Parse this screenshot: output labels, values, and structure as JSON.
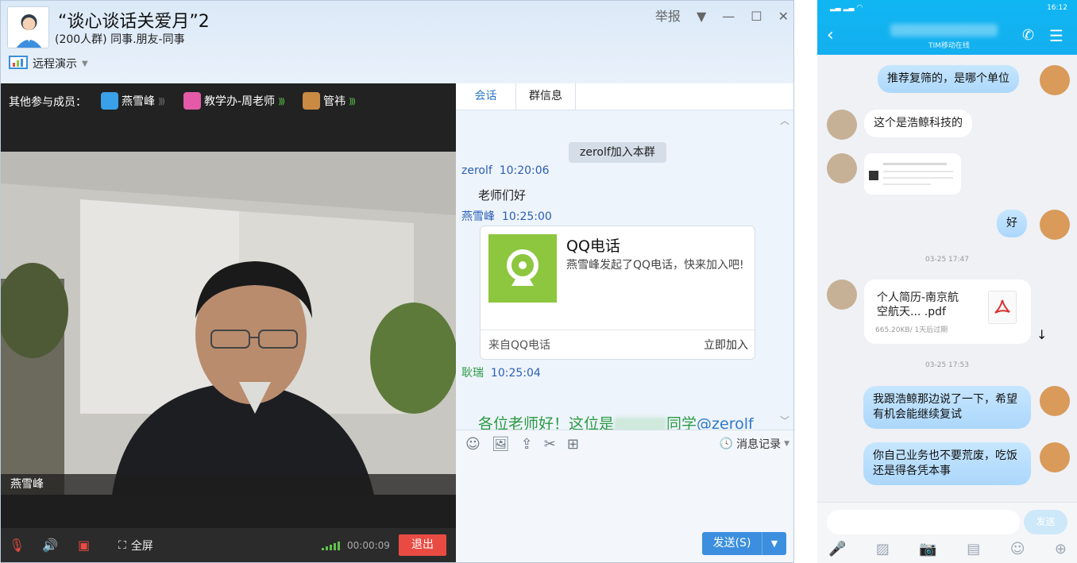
{
  "window": {
    "title": "“谈心谈话关爱月”2",
    "subtitle": "(200人群) 同事.朋友-同事",
    "report": "举报",
    "remote_demo": "远程演示"
  },
  "video": {
    "members_label": "其他参与成员：",
    "members": [
      {
        "name": "燕雪峰",
        "color": "#3aa0e8"
      },
      {
        "name": "教学办-周老师",
        "color": "#e55aa8"
      },
      {
        "name": "管祎",
        "color": "#c98a43"
      }
    ],
    "speaker_name": "燕雪峰",
    "fullscreen_label": "全屏",
    "timer": "00:00:09",
    "exit_label": "退出"
  },
  "chat": {
    "tabs": [
      "会话",
      "群信息"
    ],
    "system_message": "zerolf加入本群",
    "messages": [
      {
        "sender": "zerolf",
        "time": "10:20:06",
        "text": "老师们好"
      },
      {
        "sender": "燕雪峰",
        "time": "10:25:00"
      },
      {
        "sender": "耿瑞",
        "time": "10:25:04"
      }
    ],
    "card": {
      "title": "QQ电话",
      "desc": "燕雪峰发起了QQ电话，快来加入吧!",
      "from": "来自QQ电话",
      "join": "立即加入"
    },
    "last_msg_prefix": "各位老师好！这位是",
    "last_msg_suffix": "同学",
    "last_msg_mention": "@zerolf",
    "history_label": "消息记录",
    "send_label": "发送(S)"
  },
  "phone": {
    "contact_status": "TIM移动在线",
    "status_time": "16:12",
    "messages": [
      {
        "side": "me",
        "text": "推荐复筛的，是哪个单位"
      },
      {
        "side": "them",
        "text": "这个是浩鲸科技的"
      },
      {
        "side": "me",
        "text": "好"
      },
      {
        "side": "me",
        "text": "我跟浩鲸那边说了一下，希望有机会能继续复试"
      },
      {
        "side": "me",
        "text": "你自己业务也不要荒废，吃饭还是得各凭本事"
      }
    ],
    "times": [
      "03-25 17:47",
      "03-25 17:53"
    ],
    "file": {
      "name_line1": "个人简历-南京航",
      "name_line2": "空航天... .pdf",
      "meta": "665.20KB/ 1天后过期"
    },
    "send_label": "发送"
  },
  "colors": {
    "qq_blue": "#3b8fde",
    "exit_red": "#e94b43",
    "mention_green": "#2b9a43",
    "phone_header": "#12b2f1"
  }
}
